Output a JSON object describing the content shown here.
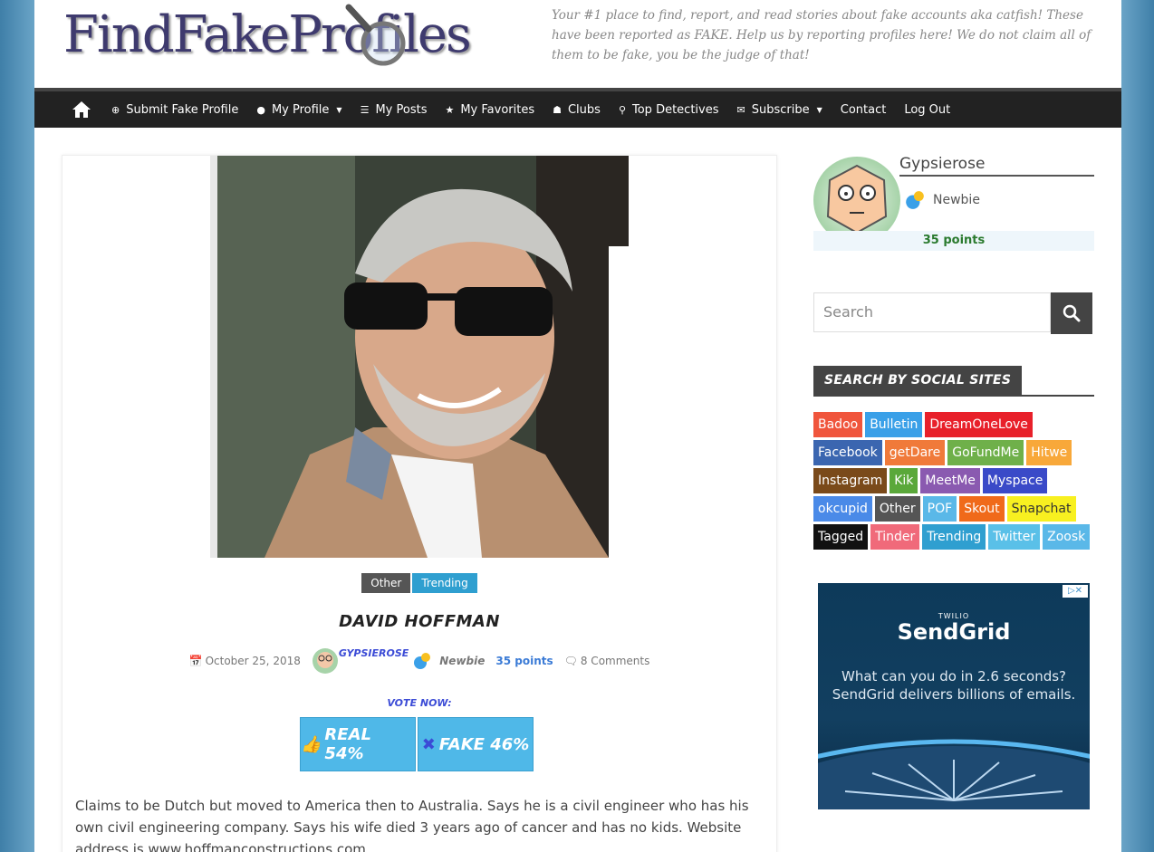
{
  "header": {
    "logo_text": "FindFakeProfiles",
    "tagline": "Your #1 place to find, report, and read stories about fake accounts aka catfish! These have been reported as FAKE. Help us by reporting profiles here! We do not claim all of them to be fake, you be the judge of that!"
  },
  "nav": {
    "items": [
      {
        "label": "Submit Fake Profile",
        "icon": "plus-circle-icon"
      },
      {
        "label": "My Profile",
        "icon": "user-icon",
        "caret": true
      },
      {
        "label": "My Posts",
        "icon": "list-icon"
      },
      {
        "label": "My Favorites",
        "icon": "star-icon"
      },
      {
        "label": "Clubs",
        "icon": "group-icon"
      },
      {
        "label": "Top Detectives",
        "icon": "search-icon"
      },
      {
        "label": "Subscribe",
        "icon": "envelope-icon",
        "caret": true
      },
      {
        "label": "Contact"
      },
      {
        "label": "Log Out"
      }
    ]
  },
  "post": {
    "tags": [
      {
        "label": "Other",
        "color": "#555555"
      },
      {
        "label": "Trending",
        "color": "#2f9fd0"
      }
    ],
    "title": "David Hoffman",
    "date": "October 25, 2018",
    "author": "GYPSIEROSE",
    "author_rank": "Newbie",
    "author_points": "35 points",
    "comments": "8 Comments",
    "vote_label": "VOTE NOW:",
    "real_label": "REAL 54%",
    "fake_label": "FAKE 46%",
    "real_percent": 54,
    "fake_percent": 46,
    "description": "Claims to be Dutch but moved to America then to Australia. Says he is a civil engineer who has his own civil engineering company. Says his wife died 3 years ago of cancer and has no kids. Website address is www.hoffmanconstructions.com"
  },
  "sidebar": {
    "username": "Gypsierose",
    "rank": "Newbie",
    "points": "35 points",
    "search_placeholder": "Search",
    "social_title": "Search by Social Sites",
    "social_sites": [
      {
        "label": "Badoo",
        "color": "#f0553c"
      },
      {
        "label": "Bulletin",
        "color": "#3aa0e8"
      },
      {
        "label": "DreamOneLove",
        "color": "#e8202a"
      },
      {
        "label": "Facebook",
        "color": "#3b66b0"
      },
      {
        "label": "getDare",
        "color": "#f07a3a"
      },
      {
        "label": "GoFundMe",
        "color": "#6fb04a"
      },
      {
        "label": "Hitwe",
        "color": "#f8a83a"
      },
      {
        "label": "Instagram",
        "color": "#7a4a1a"
      },
      {
        "label": "Kik",
        "color": "#5aa83a"
      },
      {
        "label": "MeetMe",
        "color": "#8a5ab0"
      },
      {
        "label": "Myspace",
        "color": "#3a4ac8"
      },
      {
        "label": "okcupid",
        "color": "#4a8ae8"
      },
      {
        "label": "Other",
        "color": "#555555"
      },
      {
        "label": "POF",
        "color": "#5ab8e8"
      },
      {
        "label": "Skout",
        "color": "#f06a1a"
      },
      {
        "label": "Snapchat",
        "color": "#f8f020",
        "text_color": "#333333"
      },
      {
        "label": "Tagged",
        "color": "#111111"
      },
      {
        "label": "Tinder",
        "color": "#f06a7a"
      },
      {
        "label": "Trending",
        "color": "#2f9fd0"
      },
      {
        "label": "Twitter",
        "color": "#5ac0e8"
      },
      {
        "label": "Zoosk",
        "color": "#5ab8e8"
      }
    ],
    "ad": {
      "brand_small": "TWILIO",
      "brand": "SendGrid",
      "text": "What can you do in 2.6 seconds? SendGrid delivers billions of emails."
    }
  }
}
